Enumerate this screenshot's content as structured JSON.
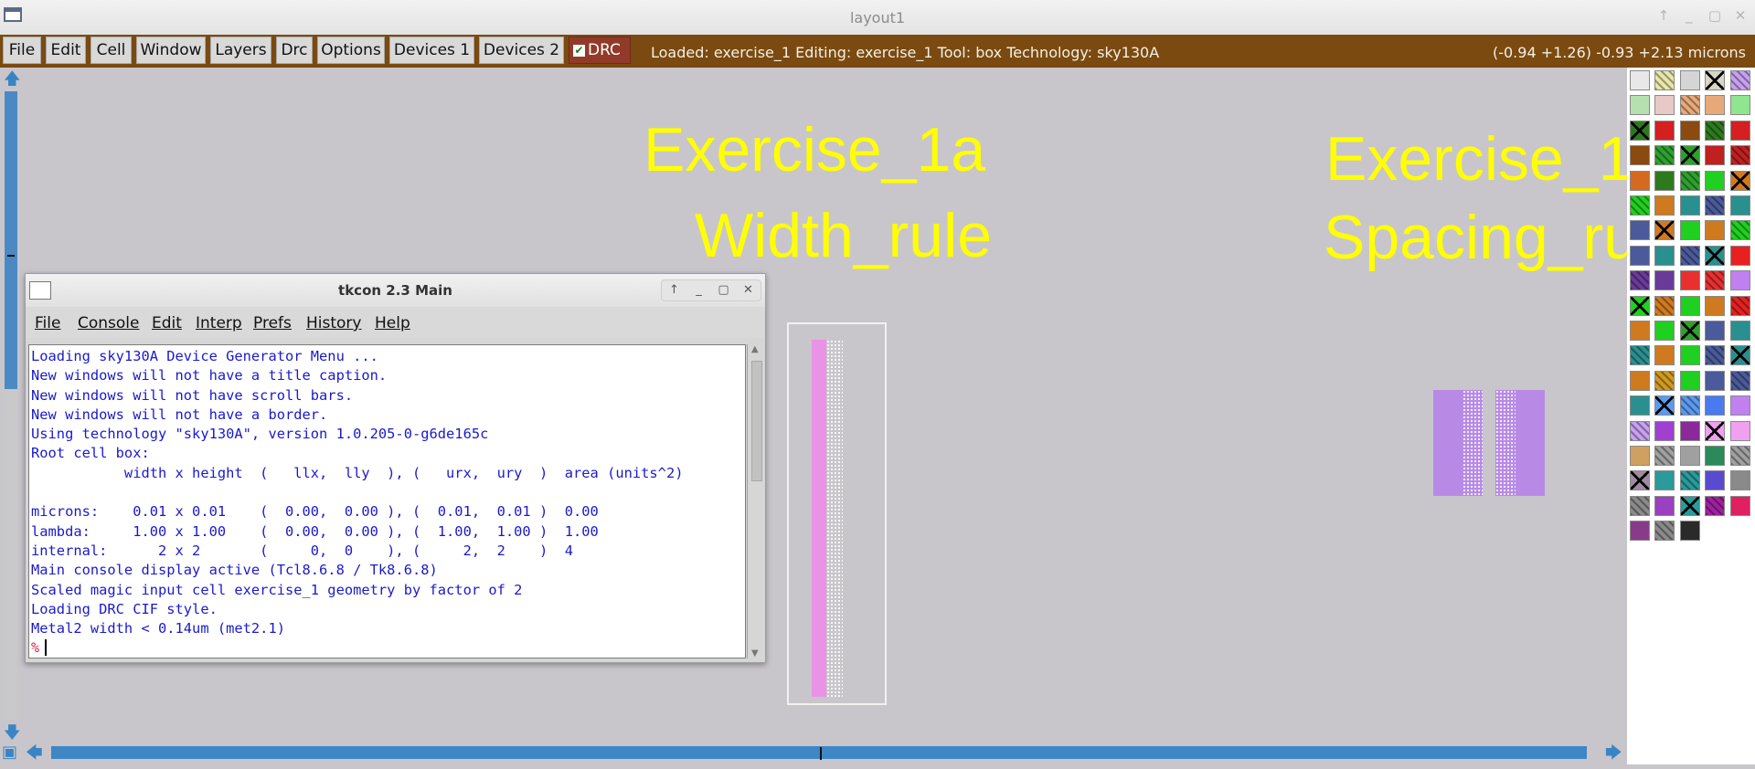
{
  "window": {
    "title": "layout1"
  },
  "menubar": {
    "items": [
      "File",
      "Edit",
      "Cell",
      "Window",
      "Layers",
      "Drc",
      "Options",
      "Devices 1",
      "Devices 2"
    ],
    "drc_toggle": {
      "label": "DRC",
      "checked": true
    },
    "status": "Loaded: exercise_1 Editing: exercise_1 Tool: box  Technology: sky130A",
    "coords": "(-0.94 +1.26) -0.93 +2.13 microns"
  },
  "canvas": {
    "label_1a_title": "Exercise_1a",
    "label_1a_sub": "Width_rule",
    "label_1b_title": "Exercise_1",
    "label_1b_sub": "Spacing_ru"
  },
  "tkcon": {
    "title": "tkcon 2.3 Main",
    "menu": [
      "File",
      "Console",
      "Edit",
      "Interp",
      "Prefs",
      "History",
      "Help"
    ],
    "lines": [
      "Loading sky130A Device Generator Menu ...",
      "New windows will not have a title caption.",
      "New windows will not have scroll bars.",
      "New windows will not have a border.",
      "Using technology \"sky130A\", version 1.0.205-0-g6de165c",
      "Root cell box:",
      "           width x height  (   llx,  lly  ), (   urx,  ury  )  area (units^2)",
      "",
      "microns:    0.01 x 0.01    (  0.00,  0.00 ), (  0.01,  0.01 )  0.00",
      "lambda:     1.00 x 1.00    (  0.00,  0.00 ), (  1.00,  1.00 )  1.00",
      "internal:      2 x 2       (     0,  0    ), (     2,  2    )  4",
      "Main console display active (Tcl8.6.8 / Tk8.6.8)",
      "Scaled magic input cell exercise_1 geometry by factor of 2",
      "Loading DRC CIF style.",
      "Metal2 width < 0.14um (met2.1)"
    ],
    "prompt": "%"
  },
  "palette": {
    "colors": [
      "#e8e8e8",
      "#e9e6a8",
      "#d5d5d5",
      "#d9d6c2",
      "#c8a0f0",
      "#b6e0b0",
      "#e9c8c8",
      "#e8a97a",
      "#e8a97a",
      "#8fe68f",
      "#2d7a1e",
      "#d42020",
      "#8a4a10",
      "#2d7a1e",
      "#d42020",
      "#8a4a10",
      "#2ea02e",
      "#2ea02e",
      "#c02020",
      "#c02020",
      "#d46a20",
      "#2d7a1e",
      "#2ea02e",
      "#20d020",
      "#d07a20",
      "#20d020",
      "#d07a20",
      "#2a8f8f",
      "#4a5a9a",
      "#2a8f8f",
      "#4a5a9a",
      "#d07a20",
      "#20d020",
      "#d07a20",
      "#20d020",
      "#4a5a9a",
      "#2a8f8f",
      "#4a5a9a",
      "#2a8f8f",
      "#e82020",
      "#6a3a9a",
      "#6a3a9a",
      "#e83030",
      "#e83030",
      "#c080f0",
      "#20d020",
      "#d07a20",
      "#20d020",
      "#d07a20",
      "#e82020",
      "#d07a20",
      "#20d020",
      "#2ea02e",
      "#4a5a9a",
      "#2a8f8f",
      "#2a8f8f",
      "#d07a20",
      "#20d020",
      "#4a5a9a",
      "#2a8f8f",
      "#d07a20",
      "#d09a20",
      "#20d020",
      "#4a5a9a",
      "#4a5a9a",
      "#2a8f8f",
      "#5a9af0",
      "#5a9af0",
      "#4a7af0",
      "#c080f0",
      "#c8a0f0",
      "#a040d0",
      "#8a2a9a",
      "#f0a0f0",
      "#f0a0f0",
      "#d0a060",
      "#a0a0a0",
      "#a0a0a0",
      "#2a8a5a",
      "#a0a0a0",
      "#a08aa0",
      "#2a9a9a",
      "#2a9a9a",
      "#5a4ad0",
      "#8a8a8a",
      "#8a8a8a",
      "#9a40c0",
      "#2a9a9a",
      "#a020a0",
      "#e02060",
      "#8a3a8a",
      "#8a8a8a",
      "#2a2a2a"
    ]
  }
}
